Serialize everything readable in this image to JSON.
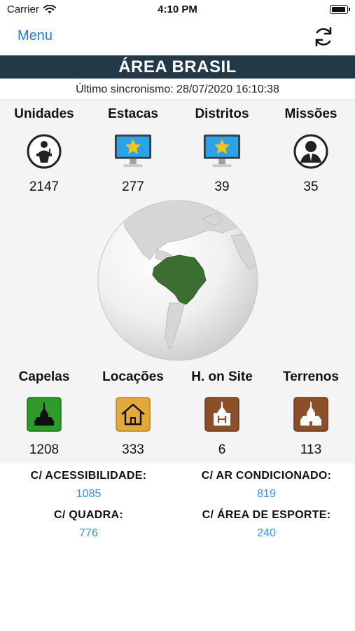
{
  "status_bar": {
    "carrier": "Carrier",
    "time": "4:10 PM"
  },
  "nav": {
    "menu_label": "Menu",
    "refresh_icon": "refresh-icon"
  },
  "header": {
    "title": "ÁREA BRASIL",
    "sync_text": "Último sincronismo: 28/07/2020 16:10:38"
  },
  "top_stats": [
    {
      "label": "Unidades",
      "value": "2147",
      "icon": "speaker-podium-icon"
    },
    {
      "label": "Estacas",
      "value": "277",
      "icon": "monitor-star-icon"
    },
    {
      "label": "Distritos",
      "value": "39",
      "icon": "monitor-star-icon"
    },
    {
      "label": "Missões",
      "value": "35",
      "icon": "person-suit-icon"
    }
  ],
  "globe_icon": "globe-brazil-icon",
  "bottom_stats": [
    {
      "label": "Capelas",
      "value": "1208",
      "icon": "chapel-icon",
      "color": "#2e9a2a"
    },
    {
      "label": "Locações",
      "value": "333",
      "icon": "house-icon",
      "color": "#e0a93a"
    },
    {
      "label": "H. on Site",
      "value": "6",
      "icon": "chapel-h-icon",
      "color": "#8b4f2a"
    },
    {
      "label": "Terrenos",
      "value": "113",
      "icon": "chapel-land-icon",
      "color": "#8b4f2a"
    }
  ],
  "details": [
    {
      "label": "C/ ACESSIBILIDADE:",
      "value": "1085"
    },
    {
      "label": "C/ AR CONDICIONADO:",
      "value": "819"
    },
    {
      "label": "C/ QUADRA:",
      "value": "776"
    },
    {
      "label": "C/ ÁREA DE ESPORTE:",
      "value": "240"
    }
  ],
  "colors": {
    "accent": "#1a7bf2",
    "title_bar": "#233947",
    "value_blue": "#3a8ee8",
    "brazil_green": "#3c6e31"
  }
}
